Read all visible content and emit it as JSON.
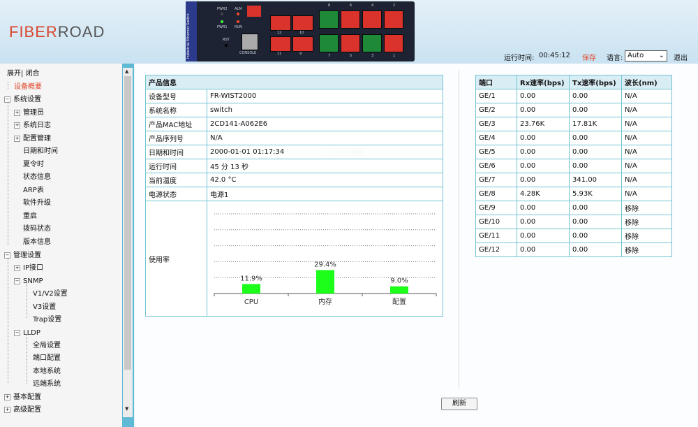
{
  "header": {
    "logo_a": "FIBER",
    "logo_b": "ROAD",
    "device_side_label": "Industrial Ethernet Switch",
    "leds": [
      "PWR2",
      "ALM",
      "PWR1",
      "RUN"
    ],
    "rst": "RST",
    "console": "CONSOLE",
    "sfp_ports": [
      "12",
      "10",
      "11",
      "9"
    ],
    "rj_top": [
      "8",
      "6",
      "4",
      "2"
    ],
    "rj_bottom": [
      "7",
      "5",
      "3",
      "1"
    ],
    "uptime_label": "运行时间:",
    "uptime_value": "00:45:12",
    "save_label": "保存",
    "language_label": "语言:",
    "language_value": "Auto",
    "logout_label": "退出"
  },
  "sidebar": {
    "expand": "展开",
    "sep": "|",
    "collapse": "闭合",
    "device_overview": "设备概要",
    "system_settings": "系统设置",
    "admin": "管理员",
    "syslog": "系统日志",
    "config_mgmt": "配置管理",
    "datetime": "日期和时间",
    "dst": "夏令时",
    "status_info": "状态信息",
    "arp": "ARP表",
    "upgrade": "软件升级",
    "reboot": "重启",
    "dip": "拨码状态",
    "version": "版本信息",
    "mgmt_settings": "管理设置",
    "ip_if": "IP接口",
    "snmp": "SNMP",
    "v1v2": "V1/V2设置",
    "v3": "V3设置",
    "trap": "Trap设置",
    "lldp": "LLDP",
    "global": "全局设置",
    "port_cfg": "端口配置",
    "local": "本地系统",
    "remote": "远端系统",
    "basic": "基本配置",
    "advanced": "高级配置"
  },
  "product": {
    "title": "产品信息",
    "rows": [
      {
        "k": "设备型号",
        "v": "FR-WIST2000"
      },
      {
        "k": "系统名称",
        "v": "switch"
      },
      {
        "k": "产品MAC地址",
        "v": "2CD141-A062E6"
      },
      {
        "k": "产品序列号",
        "v": "N/A"
      },
      {
        "k": "日期和时间",
        "v": "2000-01-01 01:17:34"
      },
      {
        "k": "运行时间",
        "v": "45 分 13 秒"
      },
      {
        "k": "当前温度",
        "v": "42.0 °C"
      },
      {
        "k": "电源状态",
        "v": "电源1"
      }
    ],
    "usage_label": "使用率"
  },
  "chart_data": {
    "type": "bar",
    "categories": [
      "CPU",
      "内存",
      "配置"
    ],
    "values": [
      11.9,
      29.4,
      9.0
    ],
    "value_labels": [
      "11.9%",
      "29.4%",
      "9.0%"
    ],
    "ylim": [
      0,
      100
    ],
    "grid": true,
    "bar_color": "#1bff1b"
  },
  "ports": {
    "headers": [
      "端口",
      "Rx速率(bps)",
      "Tx速率(bps)",
      "波长(nm)"
    ],
    "rows": [
      [
        "GE/1",
        "0.00",
        "0.00",
        "N/A"
      ],
      [
        "GE/2",
        "0.00",
        "0.00",
        "N/A"
      ],
      [
        "GE/3",
        "23.76K",
        "17.81K",
        "N/A"
      ],
      [
        "GE/4",
        "0.00",
        "0.00",
        "N/A"
      ],
      [
        "GE/5",
        "0.00",
        "0.00",
        "N/A"
      ],
      [
        "GE/6",
        "0.00",
        "0.00",
        "N/A"
      ],
      [
        "GE/7",
        "0.00",
        "341.00",
        "N/A"
      ],
      [
        "GE/8",
        "4.28K",
        "5.93K",
        "N/A"
      ],
      [
        "GE/9",
        "0.00",
        "0.00",
        "移除"
      ],
      [
        "GE/10",
        "0.00",
        "0.00",
        "移除"
      ],
      [
        "GE/11",
        "0.00",
        "0.00",
        "移除"
      ],
      [
        "GE/12",
        "0.00",
        "0.00",
        "移除"
      ]
    ]
  },
  "refresh_label": "刷新"
}
